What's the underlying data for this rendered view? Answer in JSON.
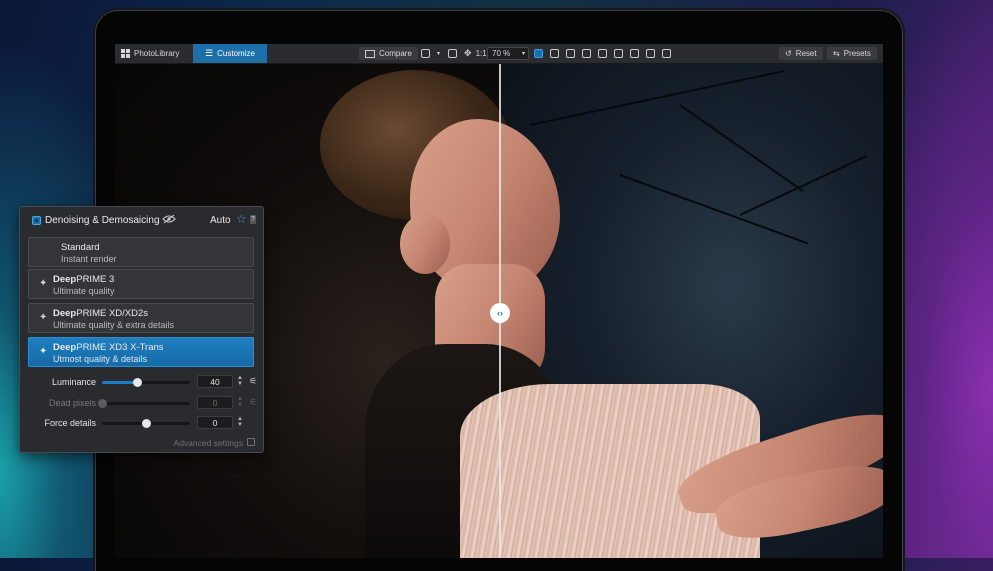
{
  "toolbar": {
    "photolibrary_label": "PhotoLibrary",
    "customize_label": "Customize",
    "compare_label": "Compare",
    "one_to_one_label": "1:1",
    "zoom_value": "70 %",
    "reset_label": "Reset",
    "presets_label": "Presets"
  },
  "panel": {
    "title": "Denoising & Demosaicing",
    "auto_label": "Auto",
    "modes": [
      {
        "title_bold": "",
        "title": "Standard",
        "subtitle": "Instant render"
      },
      {
        "title_bold": "Deep",
        "title": "PRIME 3",
        "subtitle": "Ultimate quality"
      },
      {
        "title_bold": "Deep",
        "title": "PRIME XD/XD2s",
        "subtitle": "Ultimate quality & extra details"
      },
      {
        "title_bold": "Deep",
        "title": "PRIME XD3  X-Trans",
        "subtitle": "Utmost quality & details"
      }
    ],
    "selected_mode_index": 3,
    "sliders": [
      {
        "label": "Luminance",
        "value": "40",
        "level": 0.4,
        "enabled": true
      },
      {
        "label": "Dead pixels",
        "value": "0",
        "level": 0.0,
        "enabled": false
      },
      {
        "label": "Force details",
        "value": "0",
        "level": 0.5,
        "enabled": true
      }
    ],
    "advanced_label": "Advanced settings"
  },
  "colors": {
    "accent": "#1c6fa8",
    "selected_mode": "#1f7fc0",
    "panel_bg": "#2a2b2e"
  },
  "icons": {
    "grid": "grid-icon",
    "customize": "sliders-icon",
    "compare": "compare-icon",
    "visibility": "eye-off-icon",
    "favorite": "star-icon",
    "magic": "magic-wand-icon",
    "split": "split-arrows-icon"
  }
}
